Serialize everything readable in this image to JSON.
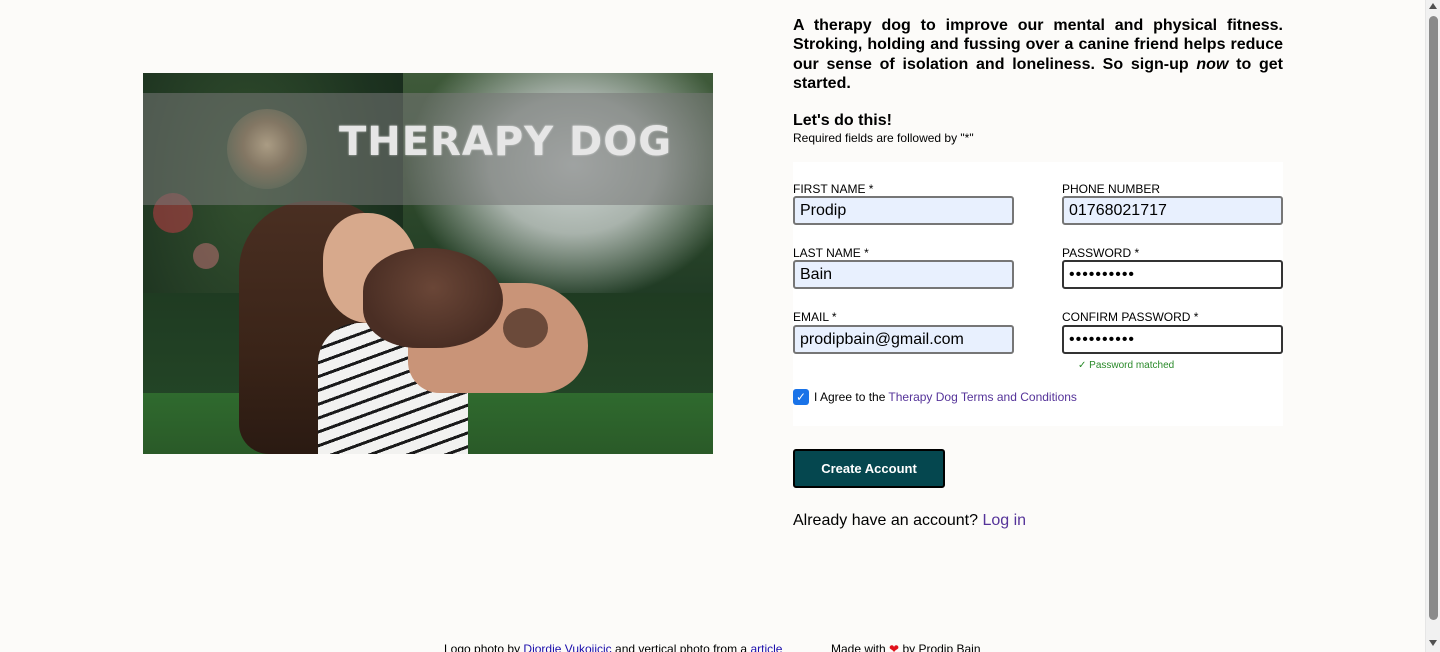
{
  "hero": {
    "logo_text": "THERAPY DOG"
  },
  "intro": {
    "text_before": "A therapy dog to improve our mental and physical fitness. Stroking, holding and fussing over a canine friend helps reduce our sense of isolation and loneliness. So sign-up ",
    "emphasis": "now",
    "text_after": " to get started."
  },
  "form": {
    "heading": "Let's do this!",
    "required_note": "Required fields are followed by \"*\"",
    "fields": {
      "first_name": {
        "label": "FIRST NAME *",
        "value": "Prodip"
      },
      "last_name": {
        "label": "LAST NAME *",
        "value": "Bain"
      },
      "email": {
        "label": "EMAIL *",
        "value": "prodipbain@gmail.com"
      },
      "phone": {
        "label": "PHONE NUMBER",
        "value": "01768021717"
      },
      "password": {
        "label": "PASSWORD *",
        "value": "••••••••••"
      },
      "confirm_password": {
        "label": "CONFIRM PASSWORD *",
        "value": "••••••••••"
      }
    },
    "password_status": "✓ Password matched",
    "agree": {
      "checked": true,
      "prefix": "I Agree to the",
      "link": "Therapy Dog Terms and Conditions"
    },
    "submit_label": "Create Account",
    "login_prompt": "Already have an account?",
    "login_link": "Log in"
  },
  "footer": {
    "credit_prefix": "Logo photo by",
    "credit_link": "Djordje Vukojicic",
    "credit_middle": "and vertical photo from a",
    "credit_link2": "article",
    "made_with": "Made with",
    "made_by": "by Prodip Bain"
  },
  "colors": {
    "button_bg": "#05474f",
    "link": "#553399",
    "autofill_bg": "#e8f0fe",
    "success": "#2a8a2a"
  }
}
